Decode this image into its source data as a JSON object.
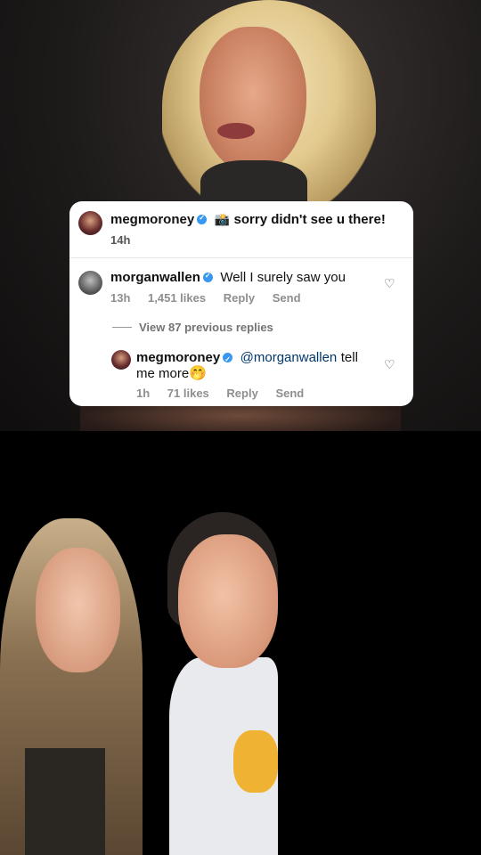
{
  "comments": {
    "top": {
      "username": "megmoroney",
      "emoji": "📸",
      "text": "sorry didn't see u there!",
      "time": "14h"
    },
    "reply1": {
      "username": "morganwallen",
      "text": "Well I surely saw you",
      "time": "13h",
      "likes": "1,451 likes",
      "reply_label": "Reply",
      "send_label": "Send"
    },
    "view_previous": "View 87 previous replies",
    "reply2": {
      "username": "megmoroney",
      "mention": "@morganwallen",
      "text": "tell me more",
      "emoji": "🤭",
      "time": "1h",
      "likes": "71 likes",
      "reply_label": "Reply",
      "send_label": "Send"
    }
  },
  "icons": {
    "heart": "heart-outline-icon",
    "verified": "verified-badge-icon"
  },
  "colors": {
    "verified_blue": "#3897f0",
    "mention_blue": "#00376b"
  }
}
